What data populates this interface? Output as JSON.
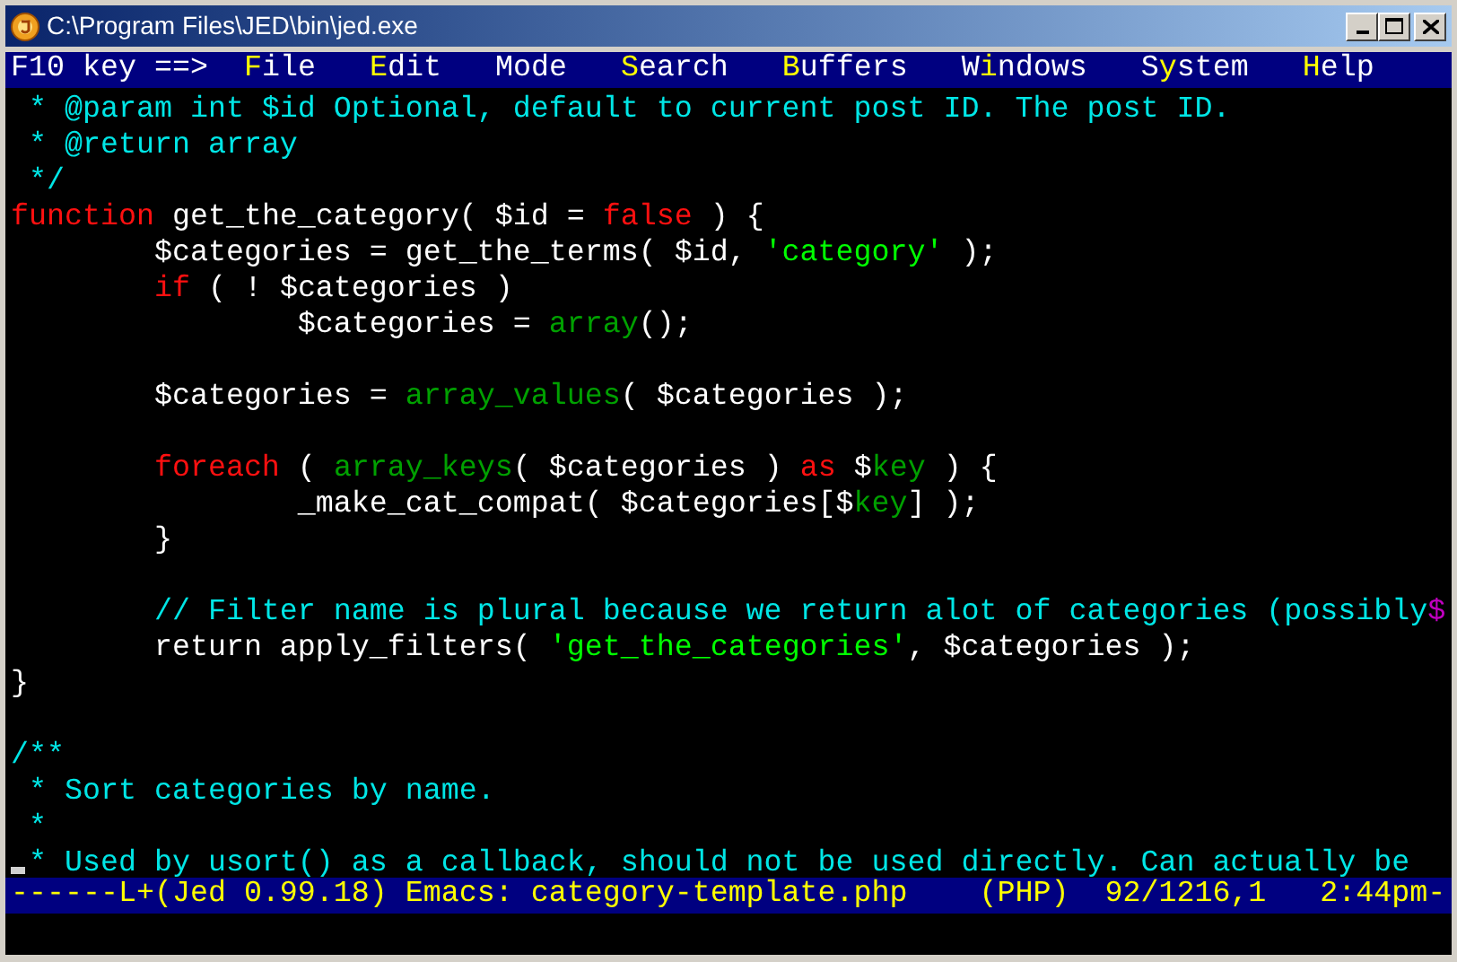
{
  "window": {
    "title": "C:\\Program Files\\JED\\bin\\jed.exe"
  },
  "menu_bar": {
    "prompt": "F10 key ==>",
    "items": [
      {
        "key": "F",
        "post": "ile"
      },
      {
        "key": "E",
        "post": "dit"
      },
      {
        "pre": "Mode"
      },
      {
        "key": "S",
        "post": "earch"
      },
      {
        "key": "B",
        "post": "uffers"
      },
      {
        "pre": "W",
        "key": "i",
        "post": "ndows"
      },
      {
        "pre": "S",
        "key": "y",
        "post": "stem"
      },
      {
        "key": "H",
        "post": "elp"
      }
    ]
  },
  "editor": {
    "lines": [
      {
        "kind": "code",
        "tokens": [
          {
            "kind": "comment",
            "text": " * @param int $id Optional, default to current post ID. The post ID."
          }
        ]
      },
      {
        "kind": "code",
        "tokens": [
          {
            "kind": "comment",
            "text": " * @return array"
          }
        ]
      },
      {
        "kind": "code",
        "tokens": [
          {
            "kind": "comment",
            "text": " */"
          }
        ]
      },
      {
        "kind": "code",
        "tokens": [
          {
            "kind": "keyword",
            "text": "function"
          },
          {
            "kind": "plain",
            "text": " get_the_category( $id = "
          },
          {
            "kind": "keyword",
            "text": "false"
          },
          {
            "kind": "plain",
            "text": " ) {"
          }
        ]
      },
      {
        "kind": "code",
        "tokens": [
          {
            "kind": "plain",
            "text": "        $categories = get_the_terms( $id, "
          },
          {
            "kind": "string",
            "text": "'category'"
          },
          {
            "kind": "plain",
            "text": " );"
          }
        ]
      },
      {
        "kind": "code",
        "tokens": [
          {
            "kind": "keyword",
            "text": "        if"
          },
          {
            "kind": "plain",
            "text": " ( ! $categories )"
          }
        ]
      },
      {
        "kind": "code",
        "tokens": [
          {
            "kind": "plain",
            "text": "                $categories = "
          },
          {
            "kind": "builtin",
            "text": "array"
          },
          {
            "kind": "plain",
            "text": "();"
          }
        ]
      },
      {
        "kind": "blank"
      },
      {
        "kind": "code",
        "tokens": [
          {
            "kind": "plain",
            "text": "        $categories = "
          },
          {
            "kind": "builtin",
            "text": "array_values"
          },
          {
            "kind": "plain",
            "text": "( $categories );"
          }
        ]
      },
      {
        "kind": "blank"
      },
      {
        "kind": "code",
        "tokens": [
          {
            "kind": "keyword",
            "text": "        foreach"
          },
          {
            "kind": "plain",
            "text": " ( "
          },
          {
            "kind": "builtin",
            "text": "array_keys"
          },
          {
            "kind": "plain",
            "text": "( $categories ) "
          },
          {
            "kind": "keyword",
            "text": "as"
          },
          {
            "kind": "plain",
            "text": " $"
          },
          {
            "kind": "builtin",
            "text": "key"
          },
          {
            "kind": "plain",
            "text": " ) {"
          }
        ]
      },
      {
        "kind": "code",
        "tokens": [
          {
            "kind": "plain",
            "text": "                _make_cat_compat( $categories[$"
          },
          {
            "kind": "builtin",
            "text": "key"
          },
          {
            "kind": "plain",
            "text": "] );"
          }
        ]
      },
      {
        "kind": "code",
        "tokens": [
          {
            "kind": "plain",
            "text": "        }"
          }
        ]
      },
      {
        "kind": "blank"
      },
      {
        "kind": "code",
        "tokens": [
          {
            "kind": "comment",
            "text": "        // Filter name is plural because we return alot of categories (possibly"
          },
          {
            "kind": "overflow",
            "text": "$"
          }
        ]
      },
      {
        "kind": "code",
        "tokens": [
          {
            "kind": "plain",
            "text": "        return apply_filters( "
          },
          {
            "kind": "string",
            "text": "'get_the_categories'"
          },
          {
            "kind": "plain",
            "text": ", $categories );"
          }
        ]
      },
      {
        "kind": "code",
        "tokens": [
          {
            "kind": "plain",
            "text": "}"
          }
        ]
      },
      {
        "kind": "blank"
      },
      {
        "kind": "code",
        "tokens": [
          {
            "kind": "comment",
            "text": "/**"
          }
        ]
      },
      {
        "kind": "code",
        "tokens": [
          {
            "kind": "comment",
            "text": " * Sort categories by name."
          }
        ]
      },
      {
        "kind": "code",
        "tokens": [
          {
            "kind": "comment",
            "text": " *"
          }
        ]
      },
      {
        "kind": "code",
        "cursor": true,
        "tokens": [
          {
            "kind": "comment",
            "text": " * Used by usort() as a callback, should not be used directly. Can actually be"
          }
        ]
      }
    ]
  },
  "status_line": "------L+(Jed 0.99.18) Emacs: category-template.php    (PHP)  92/1216,1   2:44pm-"
}
